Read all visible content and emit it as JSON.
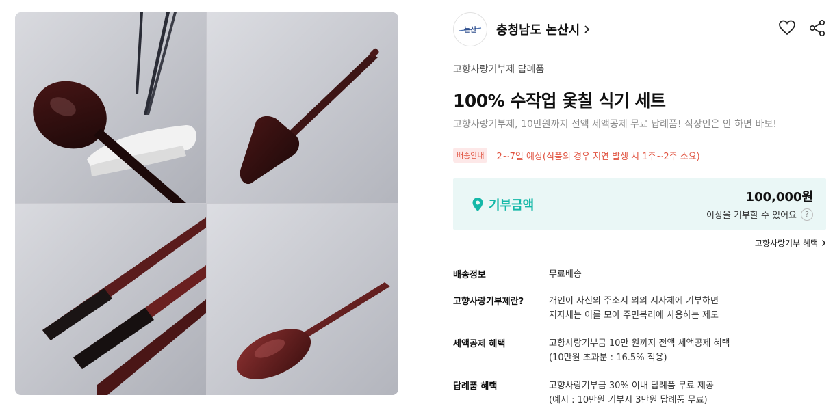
{
  "seller": {
    "logo_text": "논산",
    "name": "충청남도 논산시"
  },
  "actions": {
    "like_icon": "heart-icon",
    "share_icon": "share-icon"
  },
  "product": {
    "category": "고향사랑기부제 답례품",
    "title": "100% 수작업 옻칠 식기 세트",
    "subtitle": "고향사랑기부제, 10만원까지 전액 세액공제 무료 답례품! 직장인은 안 하면 바보!"
  },
  "shipping_notice": {
    "badge": "배송안내",
    "eta": "2~7일 예상(식품의 경우 지연 발생 시 1주~2주 소요)"
  },
  "donation": {
    "label": "기부금액",
    "amount": "100,000원",
    "note": "이상을 기부할 수 있어요",
    "help": "?"
  },
  "benefit_link": "고향사랑기부 혜택",
  "details": [
    {
      "key": "배송정보",
      "lines": [
        "무료배송"
      ]
    },
    {
      "key": "고향사랑기부제란?",
      "lines": [
        "개인이 자신의 주소지 외의 지자체에 기부하면",
        "지자체는 이를 모아 주민복리에 사용하는 제도"
      ]
    },
    {
      "key": "세액공제 혜택",
      "lines": [
        "고향사랑기부금 10만 원까지 전액 세액공제 혜택",
        "(10만원 초과분 : 16.5% 적용)"
      ]
    },
    {
      "key": "답례품 혜택",
      "lines": [
        "고향사랑기부금 30% 이내 답례품 무료 제공",
        "(예시 : 10만원 기부시 3만원 답례품 무료)"
      ]
    }
  ],
  "colors": {
    "accent_teal": "#15b8a8",
    "notice_red": "#e0523f",
    "donation_bg": "#eaf7f6"
  }
}
